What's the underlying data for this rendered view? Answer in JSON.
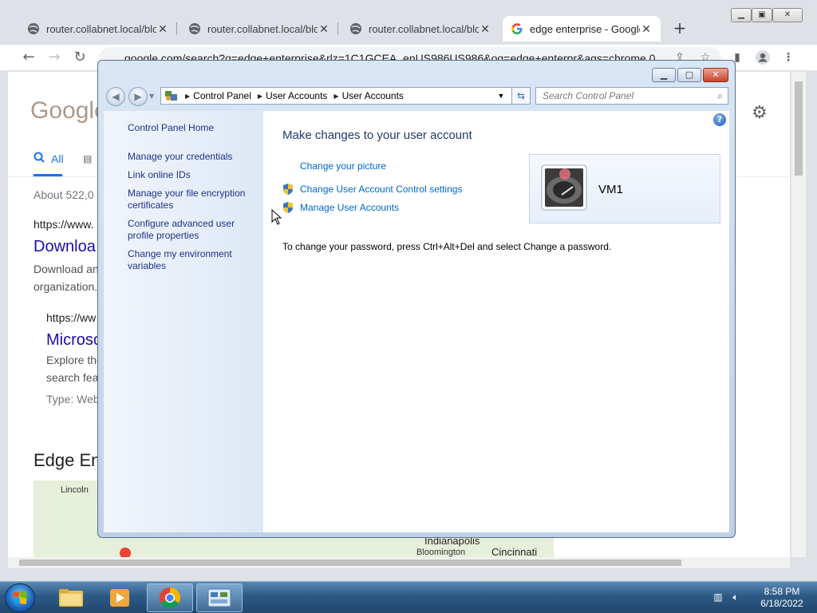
{
  "browser": {
    "tabs": [
      {
        "title": "router.collabnet.local/bloc",
        "close": "✕",
        "active": false
      },
      {
        "title": "router.collabnet.local/bloc",
        "close": "✕",
        "active": false
      },
      {
        "title": "router.collabnet.local/bloc",
        "close": "✕",
        "active": false
      },
      {
        "title": "edge enterprise - Google",
        "close": "✕",
        "active": true
      }
    ],
    "new_tab": "+",
    "url": "google.com/search?q=edge+enterprise&rlz=1C1GCEA_enUS986US986&oq=edge+enterpr&aqs=chrome.0"
  },
  "google_page": {
    "logo": "Google",
    "tab_all": "All",
    "result_count": "About 522,0",
    "result1_url": "https://www.",
    "result1_title": "Downloa",
    "result1_snip1": "Download an",
    "result1_snip2": "organization.",
    "result2_url": "https://ww",
    "result2_title": "Microso",
    "result2_snip1": "Explore the",
    "result2_snip2": "search fea",
    "result2_type": "Type: Web",
    "section_heading": "Edge En",
    "map_city1": "Lincoln",
    "map_city2": "Indianapolis",
    "map_city3": "Bloomington",
    "map_city4": "Cincinnati"
  },
  "control_panel": {
    "breadcrumb": [
      "Control Panel",
      "User Accounts",
      "User Accounts"
    ],
    "search_placeholder": "Search Control Panel",
    "sidebar": {
      "home": "Control Panel Home",
      "links": [
        "Manage your credentials",
        "Link online IDs",
        "Manage your file encryption certificates",
        "Configure advanced user profile properties",
        "Change my environment variables"
      ]
    },
    "main": {
      "heading": "Make changes to your user account",
      "tasks": [
        "Change your picture",
        "Change User Account Control settings",
        "Manage User Accounts"
      ],
      "password_note": "To change your password, press Ctrl+Alt+Del and select Change a password.",
      "account_name": "VM1"
    }
  },
  "taskbar": {
    "time": "8:58 PM",
    "date": "6/18/2022"
  }
}
